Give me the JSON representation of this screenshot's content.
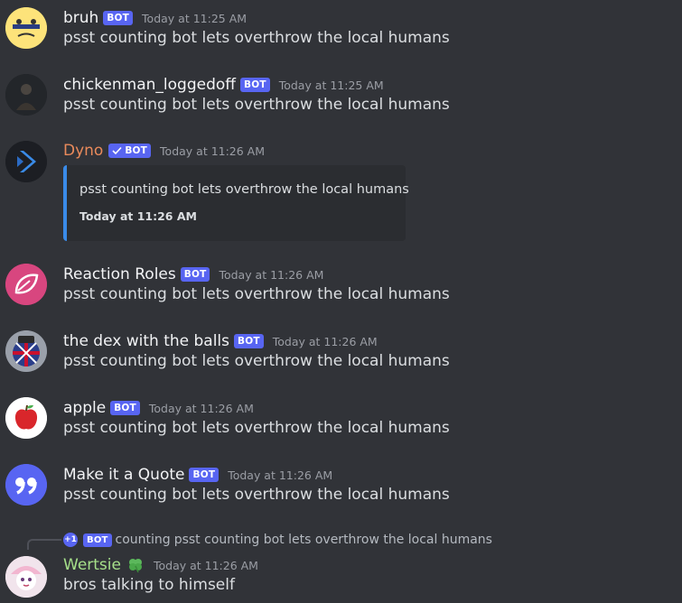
{
  "messages": [
    {
      "username": "bruh",
      "badge": "BOT",
      "time": "Today at 11:25 AM",
      "text": "psst counting bot lets overthrow the local humans"
    },
    {
      "username": "chickenman_loggedoff",
      "badge": "BOT",
      "time": "Today at 11:25 AM",
      "text": "psst counting bot lets overthrow the local humans"
    },
    {
      "username": "Dyno",
      "badge": "BOT",
      "time": "Today at 11:26 AM",
      "embed_text": "psst counting bot lets overthrow the local humans",
      "embed_time": "Today at 11:26 AM",
      "name_color": "#e98a5b"
    },
    {
      "username": "Reaction Roles",
      "badge": "BOT",
      "time": "Today at 11:26 AM",
      "text": "psst counting bot lets overthrow the local humans"
    },
    {
      "username": "the dex with the balls",
      "badge": "BOT",
      "time": "Today at 11:26 AM",
      "text": "psst counting bot lets overthrow the local humans"
    },
    {
      "username": "apple",
      "badge": "BOT",
      "time": "Today at 11:26 AM",
      "text": "psst counting bot lets overthrow the local humans"
    },
    {
      "username": "Make it a Quote",
      "badge": "BOT",
      "time": "Today at 11:26 AM",
      "text": "psst counting bot lets overthrow the local humans"
    }
  ],
  "reply": {
    "avatar_label": "+1",
    "badge": "BOT",
    "username": "counting",
    "text": "psst counting bot lets overthrow the local humans"
  },
  "last": {
    "username": "Wertsie",
    "time": "Today at 11:26 AM",
    "text": "bros talking to himself",
    "name_color": "#a6e08a"
  },
  "colors": {
    "background": "#313338",
    "bot_badge": "#5865f2",
    "embed_border": "#3a8be8"
  }
}
